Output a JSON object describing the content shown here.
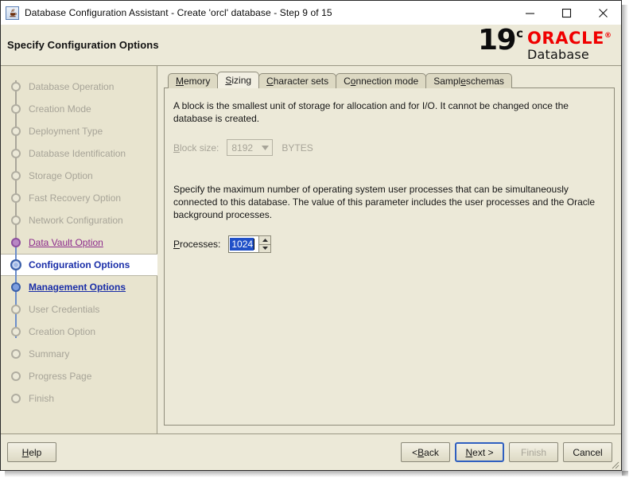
{
  "window": {
    "title": "Database Configuration Assistant - Create 'orcl' database - Step 9 of 15",
    "icon": "java-app-icon",
    "controls": {
      "minimize": "minimize-icon",
      "maximize": "maximize-icon",
      "close": "close-icon"
    }
  },
  "banner": {
    "title": "Specify Configuration Options",
    "logo": {
      "version": "19",
      "suffix": "c",
      "brand": "ORACLE",
      "registered": "®",
      "product": "Database",
      "brand_color": "#f00000"
    }
  },
  "sidebar": {
    "steps": [
      {
        "label": "Database Operation",
        "state": "done"
      },
      {
        "label": "Creation Mode",
        "state": "done"
      },
      {
        "label": "Deployment Type",
        "state": "done"
      },
      {
        "label": "Database Identification",
        "state": "done"
      },
      {
        "label": "Storage Option",
        "state": "done"
      },
      {
        "label": "Fast Recovery Option",
        "state": "done"
      },
      {
        "label": "Network Configuration",
        "state": "done"
      },
      {
        "label": "Data Vault Option",
        "state": "visited"
      },
      {
        "label": "Configuration Options",
        "state": "current"
      },
      {
        "label": "Management Options",
        "state": "link"
      },
      {
        "label": "User Credentials",
        "state": "done"
      },
      {
        "label": "Creation Option",
        "state": "done"
      },
      {
        "label": "Summary",
        "state": "done"
      },
      {
        "label": "Progress Page",
        "state": "done"
      },
      {
        "label": "Finish",
        "state": "done"
      }
    ]
  },
  "tabs": [
    {
      "label": "Memory",
      "mnemonic": "M",
      "selected": false
    },
    {
      "label": "Sizing",
      "mnemonic": "S",
      "selected": true
    },
    {
      "label": "Character sets",
      "mnemonic": "C",
      "selected": false
    },
    {
      "label": "Connection mode",
      "mnemonic": "o",
      "selected": false
    },
    {
      "label": "Sample schemas",
      "mnemonic": "e",
      "selected": false
    }
  ],
  "sizing": {
    "block_description": "A block is the smallest unit of storage for allocation and for I/O. It cannot be changed once the database is created.",
    "block_size_label": "Block size:",
    "block_size_mnemonic": "B",
    "block_size_value": "8192",
    "block_size_unit": "BYTES",
    "block_size_enabled": false,
    "processes_description": "Specify the maximum number of operating system user processes that can be simultaneously connected to this database. The value of this parameter includes the user processes and the Oracle background processes.",
    "processes_label": "Processes:",
    "processes_mnemonic": "P",
    "processes_value": "1024",
    "processes_selected": true
  },
  "footer": {
    "help": "Help",
    "back": "< Back",
    "next": "Next >",
    "finish": "Finish",
    "cancel": "Cancel"
  }
}
